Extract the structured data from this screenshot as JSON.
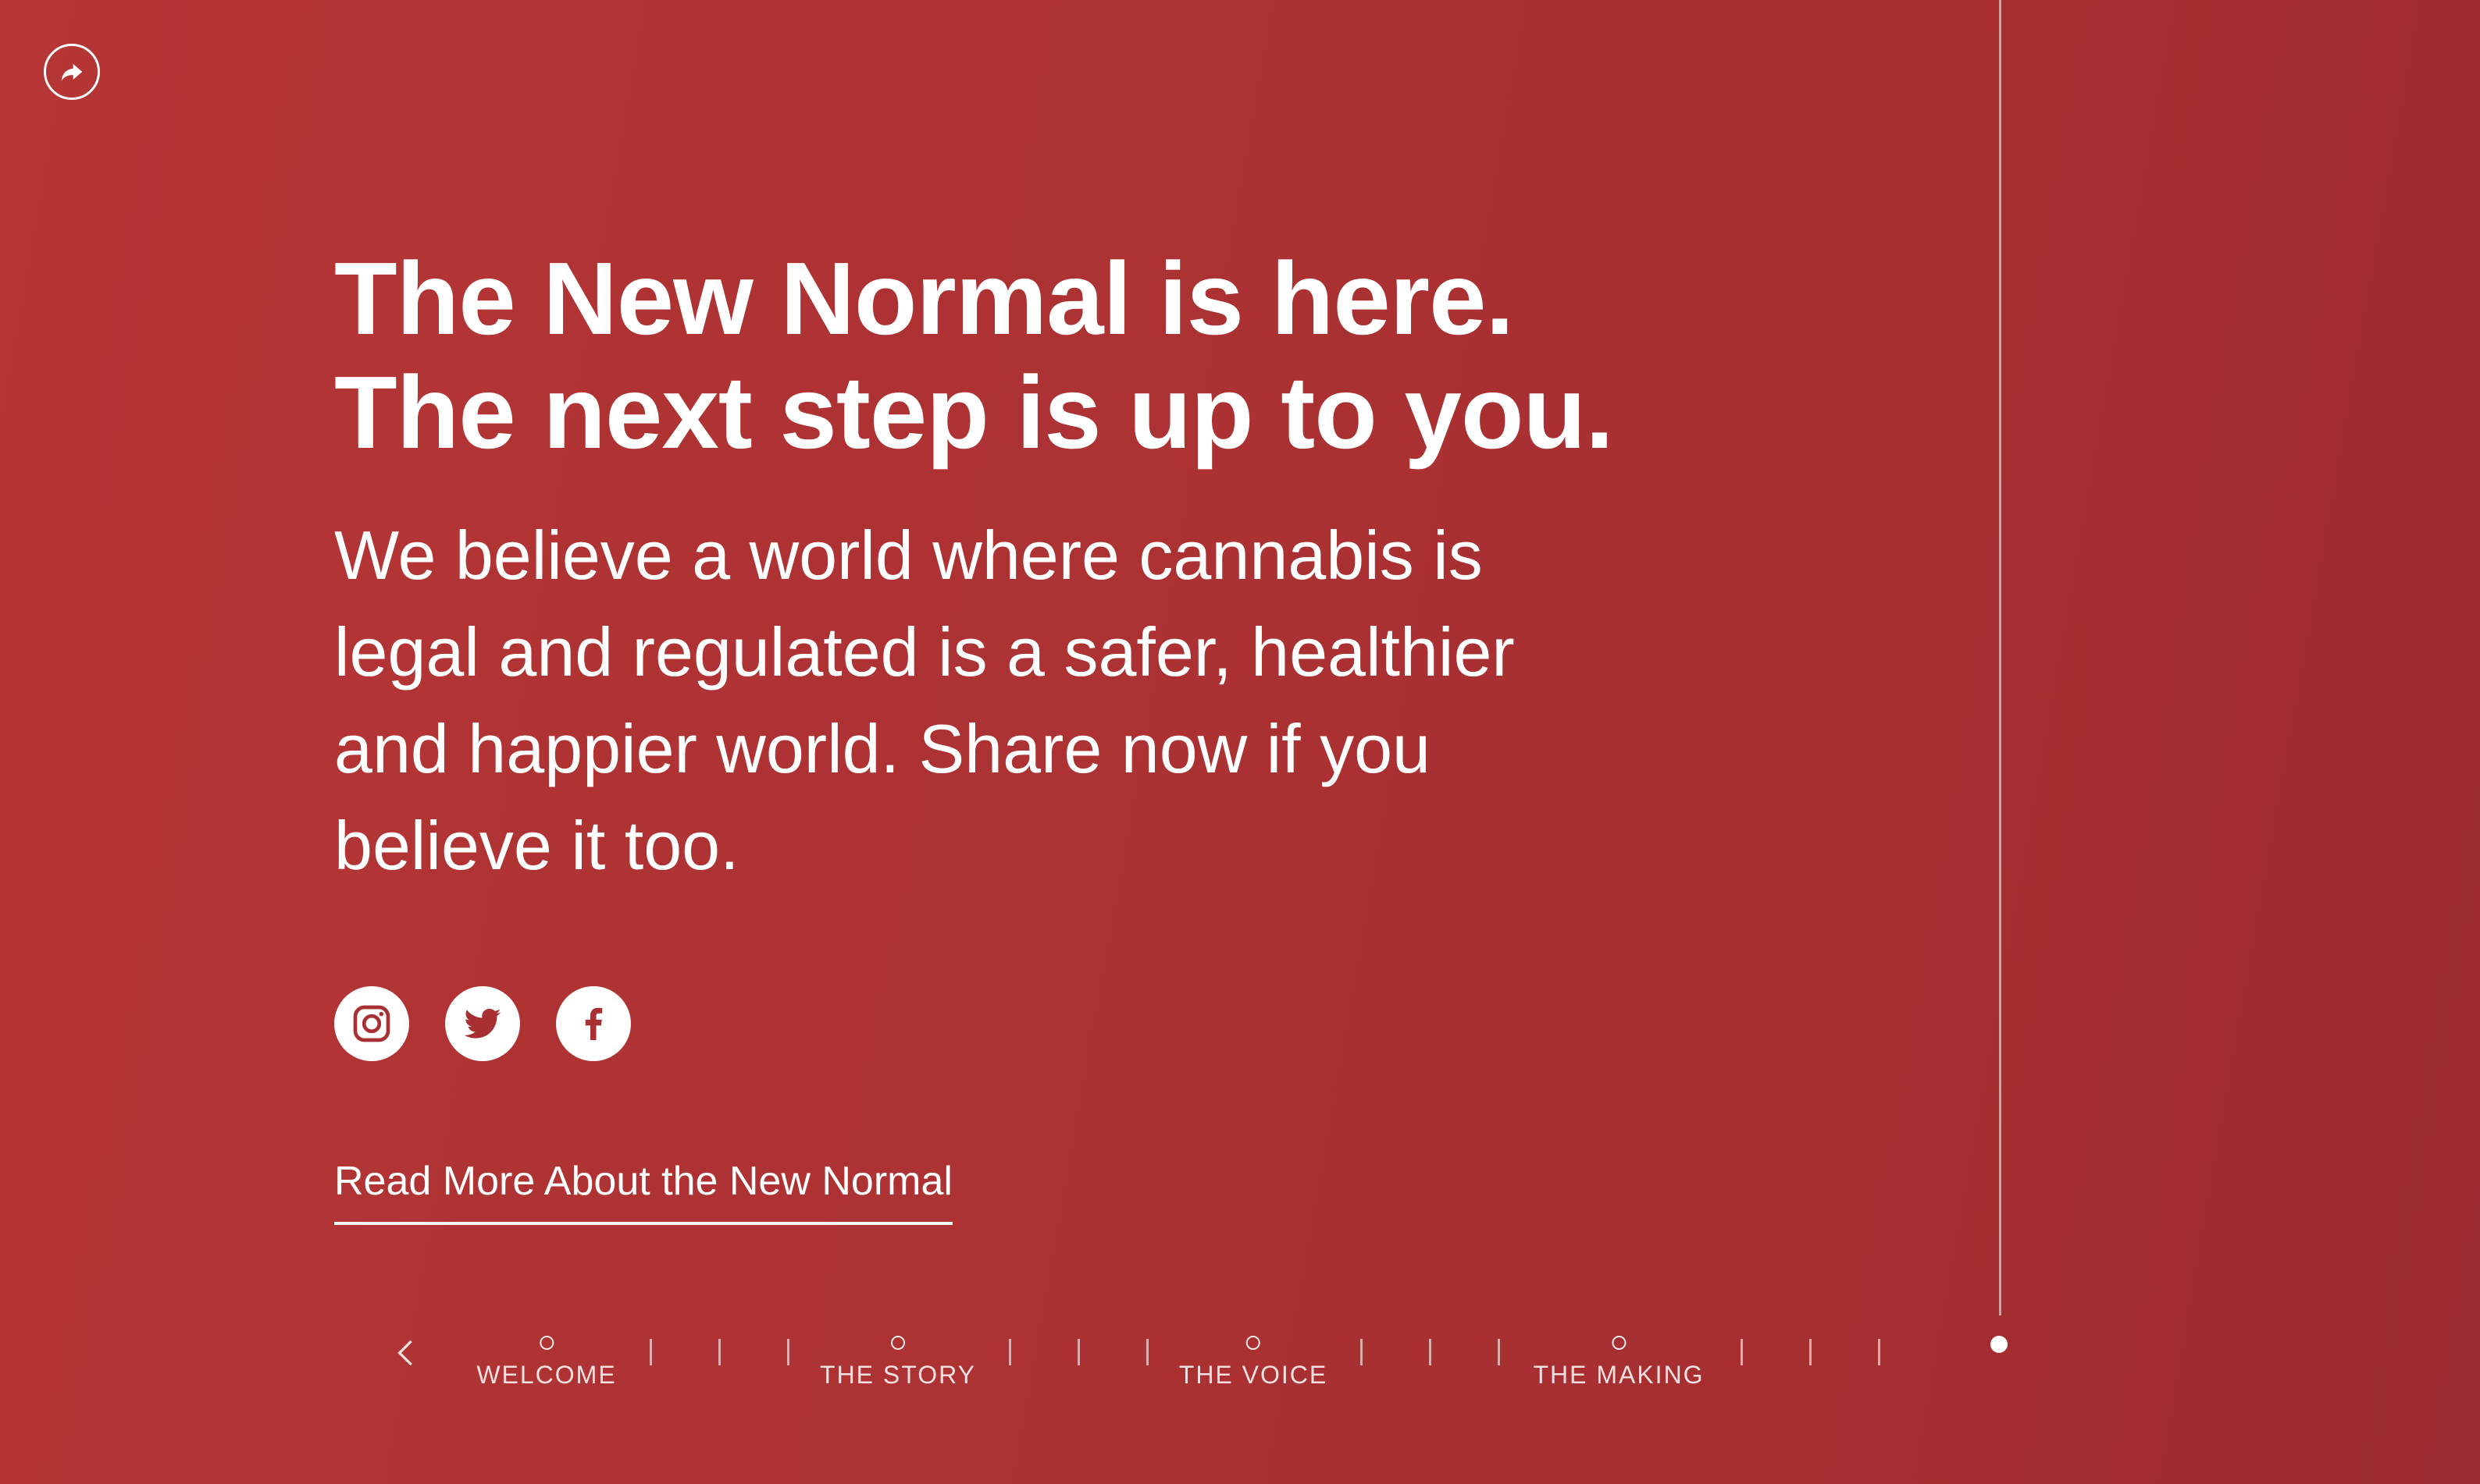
{
  "headline": {
    "line1": "The New Normal is here.",
    "line2": "The next step is up to you."
  },
  "body": {
    "text": "We believe a world where cannabis is legal and regulated is a safer, healthier and happier world. Share now if you believe it too."
  },
  "share": {
    "icon": "share-arrow-icon"
  },
  "social": [
    {
      "name": "instagram",
      "icon": "instagram-icon"
    },
    {
      "name": "twitter",
      "icon": "twitter-icon"
    },
    {
      "name": "facebook",
      "icon": "facebook-icon"
    }
  ],
  "read_more": {
    "label": "Read More About the New Normal"
  },
  "nav": {
    "prev_icon": "chevron-left-icon",
    "sections": [
      {
        "label": "WELCOME"
      },
      {
        "label": "THE STORY"
      },
      {
        "label": "THE VOICE"
      },
      {
        "label": "THE MAKING"
      }
    ],
    "active_index": 4
  },
  "colors": {
    "background": "#ad3233",
    "text": "#ffffff"
  }
}
